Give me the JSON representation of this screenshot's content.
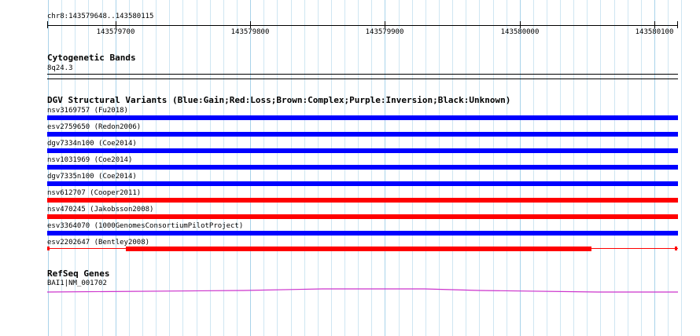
{
  "ruler": {
    "coords": "chr8:143579648..143580115",
    "tick_labels": [
      "143579700",
      "143579800",
      "143579900",
      "143580000",
      "143580100"
    ]
  },
  "cytoband": {
    "title": "Cytogenetic Bands",
    "band": "8q24.3"
  },
  "dgv": {
    "title": "DGV Structural Variants (Blue:Gain;Red:Loss;Brown:Complex;Purple:Inversion;Black:Unknown)",
    "variants": [
      {
        "label": "nsv3169757 (Fu2018)",
        "color": "#0000ff"
      },
      {
        "label": "esv2759650 (Redon2006)",
        "color": "#0000ff"
      },
      {
        "label": "dgv7334n100 (Coe2014)",
        "color": "#0000ff"
      },
      {
        "label": "nsv1031969 (Coe2014)",
        "color": "#0000ff"
      },
      {
        "label": "dgv7335n100 (Coe2014)",
        "color": "#0000ff"
      },
      {
        "label": "nsv612707 (Cooper2011)",
        "color": "#ff0000"
      },
      {
        "label": "nsv470245 (Jakobsson2008)",
        "color": "#ff0000"
      },
      {
        "label": "esv3364070 (1000GenomesConsortiumPilotProject)",
        "color": "#0000ff"
      },
      {
        "label": "esv2202647 (Bentley2008)",
        "color": "#ff0000"
      }
    ]
  },
  "refseq": {
    "title": "RefSeq Genes",
    "gene": "BAI1|NM_001702",
    "color": "#cc33cc"
  },
  "colors": {
    "grid_minor": "#cfe6f2",
    "grid_major": "#a9d3ea",
    "gain": "#0000ff",
    "loss": "#ff0000"
  }
}
